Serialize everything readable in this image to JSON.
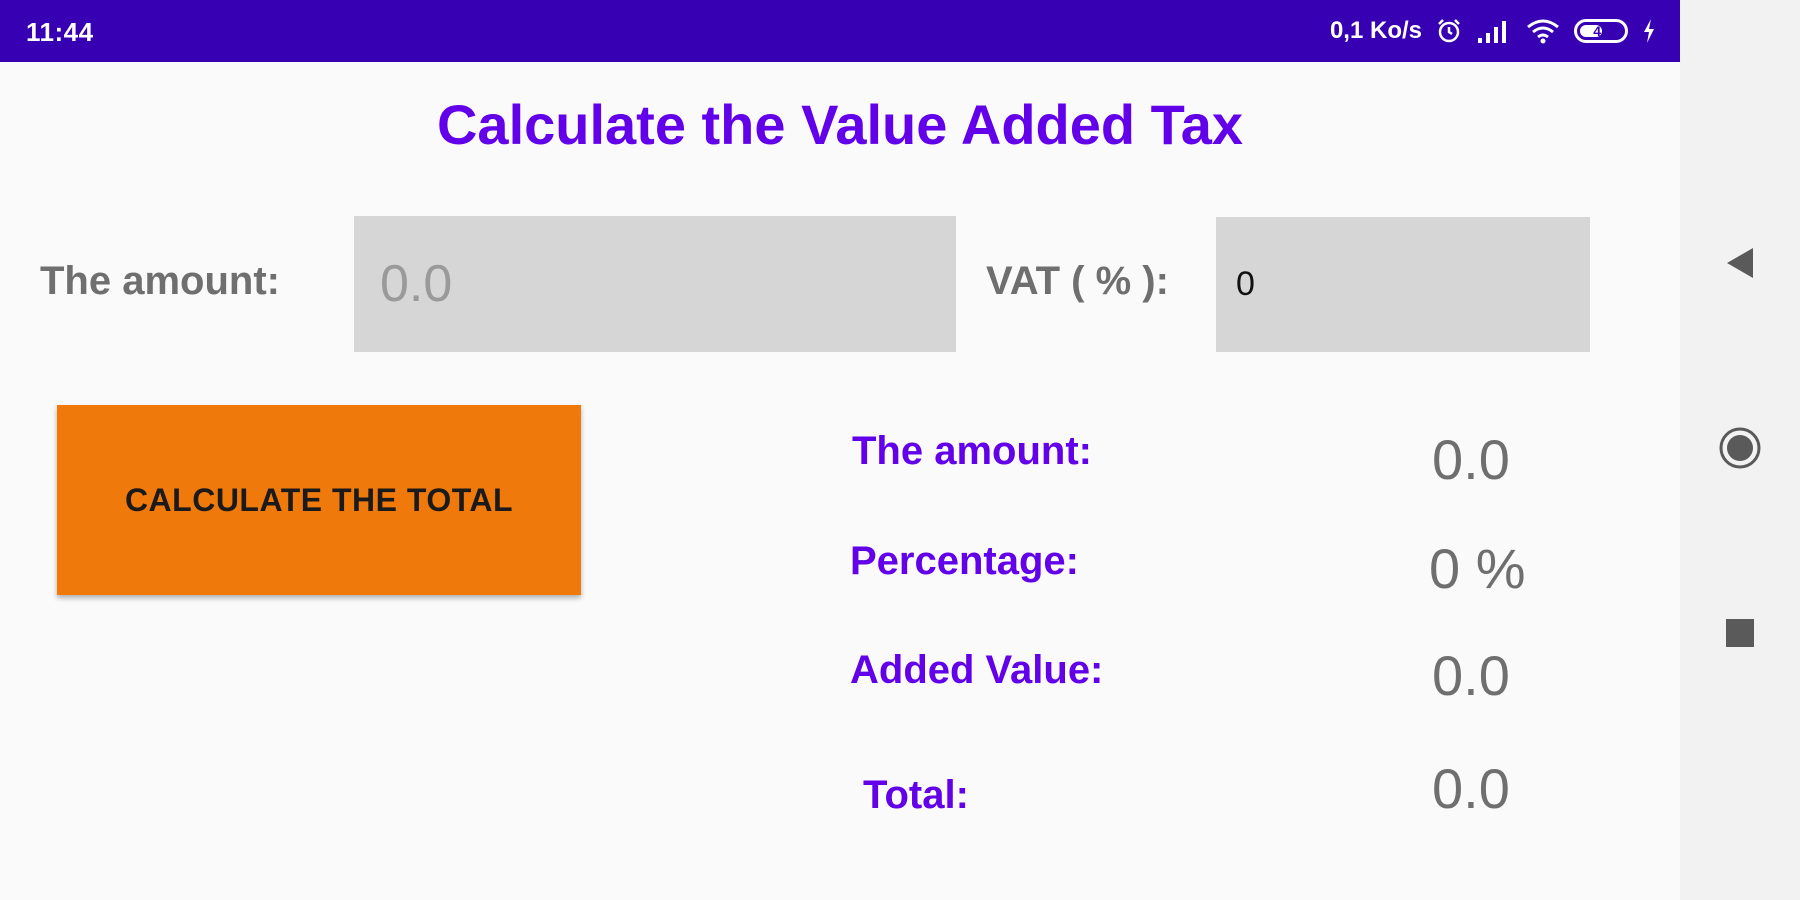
{
  "status_bar": {
    "time": "11:44",
    "net_speed": "0,1 Ko/s",
    "battery_level": "47",
    "icons": [
      "alarm-icon",
      "signal-icon",
      "wifi-icon",
      "battery-icon",
      "charging-icon"
    ]
  },
  "app": {
    "title": "Calculate the Value Added Tax",
    "accent_color": "#6200ea",
    "status_bar_color": "#3700b3",
    "button_color": "#f0790c"
  },
  "form": {
    "amount_label": "The amount:",
    "amount_placeholder": "0.0",
    "amount_value": "",
    "vat_label": "VAT ( % ):",
    "vat_value": "0",
    "calculate_label": "CALCULATE THE TOTAL"
  },
  "results": {
    "amount_label": "The amount:",
    "amount_value": "0.0",
    "percentage_label": "Percentage:",
    "percentage_value": "0 %",
    "added_value_label": "Added Value:",
    "added_value_value": "0.0",
    "total_label": "Total:",
    "total_value": "0.0"
  },
  "nav": {
    "icons": [
      "back-icon",
      "home-icon",
      "recents-icon"
    ]
  }
}
